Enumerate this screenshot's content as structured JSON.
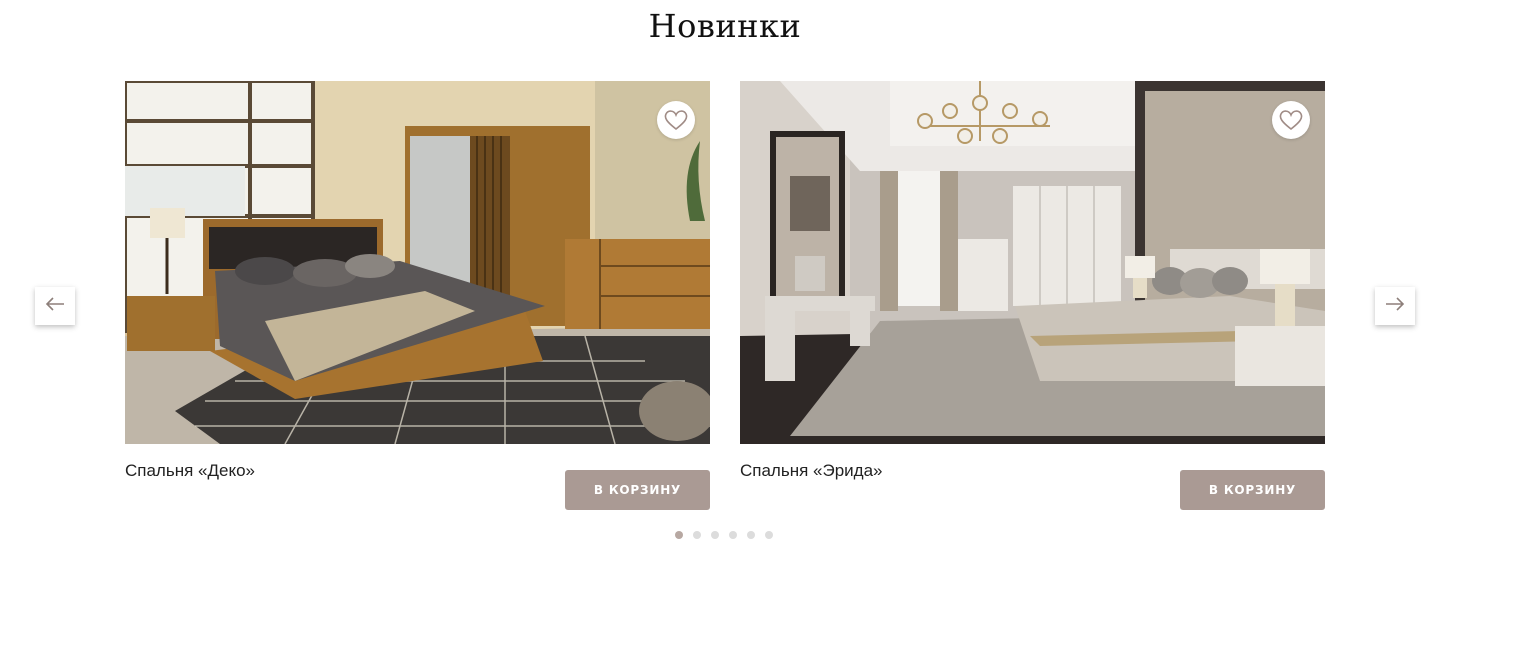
{
  "section": {
    "title": "Новинки"
  },
  "products": [
    {
      "name": "Спальня «Деко»",
      "cart_label": "В КОРЗИНУ"
    },
    {
      "name": "Спальня «Эрида»",
      "cart_label": "В КОРЗИНУ"
    }
  ],
  "carousel": {
    "prev_icon": "arrow-left-icon",
    "next_icon": "arrow-right-icon",
    "dots_count": 6,
    "active_dot": 1
  },
  "colors": {
    "button": "#aa9a94",
    "dot_active": "#b7a8a2",
    "dot_inactive": "#dcdcdc",
    "heart": "#a08c86"
  }
}
